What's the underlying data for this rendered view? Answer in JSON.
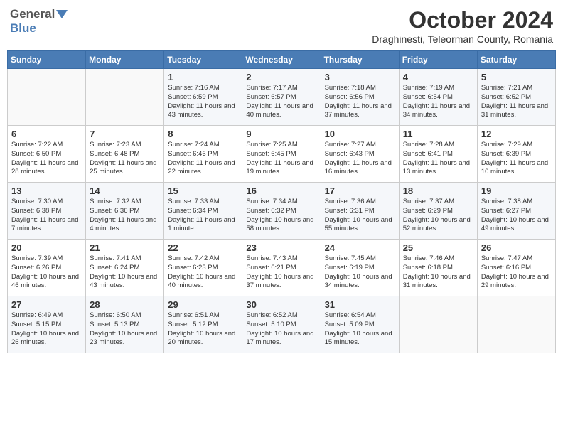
{
  "header": {
    "logo_general": "General",
    "logo_blue": "Blue",
    "month": "October 2024",
    "location": "Draghinesti, Teleorman County, Romania"
  },
  "weekdays": [
    "Sunday",
    "Monday",
    "Tuesday",
    "Wednesday",
    "Thursday",
    "Friday",
    "Saturday"
  ],
  "weeks": [
    [
      {
        "day": "",
        "info": ""
      },
      {
        "day": "",
        "info": ""
      },
      {
        "day": "1",
        "info": "Sunrise: 7:16 AM\nSunset: 6:59 PM\nDaylight: 11 hours and 43 minutes."
      },
      {
        "day": "2",
        "info": "Sunrise: 7:17 AM\nSunset: 6:57 PM\nDaylight: 11 hours and 40 minutes."
      },
      {
        "day": "3",
        "info": "Sunrise: 7:18 AM\nSunset: 6:56 PM\nDaylight: 11 hours and 37 minutes."
      },
      {
        "day": "4",
        "info": "Sunrise: 7:19 AM\nSunset: 6:54 PM\nDaylight: 11 hours and 34 minutes."
      },
      {
        "day": "5",
        "info": "Sunrise: 7:21 AM\nSunset: 6:52 PM\nDaylight: 11 hours and 31 minutes."
      }
    ],
    [
      {
        "day": "6",
        "info": "Sunrise: 7:22 AM\nSunset: 6:50 PM\nDaylight: 11 hours and 28 minutes."
      },
      {
        "day": "7",
        "info": "Sunrise: 7:23 AM\nSunset: 6:48 PM\nDaylight: 11 hours and 25 minutes."
      },
      {
        "day": "8",
        "info": "Sunrise: 7:24 AM\nSunset: 6:46 PM\nDaylight: 11 hours and 22 minutes."
      },
      {
        "day": "9",
        "info": "Sunrise: 7:25 AM\nSunset: 6:45 PM\nDaylight: 11 hours and 19 minutes."
      },
      {
        "day": "10",
        "info": "Sunrise: 7:27 AM\nSunset: 6:43 PM\nDaylight: 11 hours and 16 minutes."
      },
      {
        "day": "11",
        "info": "Sunrise: 7:28 AM\nSunset: 6:41 PM\nDaylight: 11 hours and 13 minutes."
      },
      {
        "day": "12",
        "info": "Sunrise: 7:29 AM\nSunset: 6:39 PM\nDaylight: 11 hours and 10 minutes."
      }
    ],
    [
      {
        "day": "13",
        "info": "Sunrise: 7:30 AM\nSunset: 6:38 PM\nDaylight: 11 hours and 7 minutes."
      },
      {
        "day": "14",
        "info": "Sunrise: 7:32 AM\nSunset: 6:36 PM\nDaylight: 11 hours and 4 minutes."
      },
      {
        "day": "15",
        "info": "Sunrise: 7:33 AM\nSunset: 6:34 PM\nDaylight: 11 hours and 1 minute."
      },
      {
        "day": "16",
        "info": "Sunrise: 7:34 AM\nSunset: 6:32 PM\nDaylight: 10 hours and 58 minutes."
      },
      {
        "day": "17",
        "info": "Sunrise: 7:36 AM\nSunset: 6:31 PM\nDaylight: 10 hours and 55 minutes."
      },
      {
        "day": "18",
        "info": "Sunrise: 7:37 AM\nSunset: 6:29 PM\nDaylight: 10 hours and 52 minutes."
      },
      {
        "day": "19",
        "info": "Sunrise: 7:38 AM\nSunset: 6:27 PM\nDaylight: 10 hours and 49 minutes."
      }
    ],
    [
      {
        "day": "20",
        "info": "Sunrise: 7:39 AM\nSunset: 6:26 PM\nDaylight: 10 hours and 46 minutes."
      },
      {
        "day": "21",
        "info": "Sunrise: 7:41 AM\nSunset: 6:24 PM\nDaylight: 10 hours and 43 minutes."
      },
      {
        "day": "22",
        "info": "Sunrise: 7:42 AM\nSunset: 6:23 PM\nDaylight: 10 hours and 40 minutes."
      },
      {
        "day": "23",
        "info": "Sunrise: 7:43 AM\nSunset: 6:21 PM\nDaylight: 10 hours and 37 minutes."
      },
      {
        "day": "24",
        "info": "Sunrise: 7:45 AM\nSunset: 6:19 PM\nDaylight: 10 hours and 34 minutes."
      },
      {
        "day": "25",
        "info": "Sunrise: 7:46 AM\nSunset: 6:18 PM\nDaylight: 10 hours and 31 minutes."
      },
      {
        "day": "26",
        "info": "Sunrise: 7:47 AM\nSunset: 6:16 PM\nDaylight: 10 hours and 29 minutes."
      }
    ],
    [
      {
        "day": "27",
        "info": "Sunrise: 6:49 AM\nSunset: 5:15 PM\nDaylight: 10 hours and 26 minutes."
      },
      {
        "day": "28",
        "info": "Sunrise: 6:50 AM\nSunset: 5:13 PM\nDaylight: 10 hours and 23 minutes."
      },
      {
        "day": "29",
        "info": "Sunrise: 6:51 AM\nSunset: 5:12 PM\nDaylight: 10 hours and 20 minutes."
      },
      {
        "day": "30",
        "info": "Sunrise: 6:52 AM\nSunset: 5:10 PM\nDaylight: 10 hours and 17 minutes."
      },
      {
        "day": "31",
        "info": "Sunrise: 6:54 AM\nSunset: 5:09 PM\nDaylight: 10 hours and 15 minutes."
      },
      {
        "day": "",
        "info": ""
      },
      {
        "day": "",
        "info": ""
      }
    ]
  ]
}
